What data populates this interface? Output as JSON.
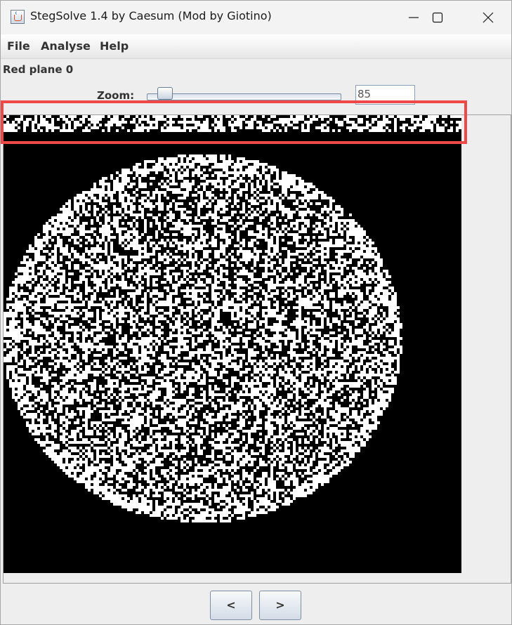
{
  "window": {
    "title": "StegSolve 1.4 by Caesum (Mod by Giotino)",
    "controls": {
      "minimize": "—",
      "maximize": "☐",
      "close": "✕"
    }
  },
  "menu": {
    "items": [
      "File",
      "Analyse",
      "Help"
    ]
  },
  "view": {
    "plane_label": "Red plane 0",
    "zoom_label": "Zoom:",
    "zoom_value": "85",
    "zoom_fraction": 0.06
  },
  "nav": {
    "prev_label": "<",
    "next_label": ">"
  },
  "colors": {
    "highlight": "#f04848",
    "canvas_bg": "#000000",
    "noise": "#ffffff"
  }
}
